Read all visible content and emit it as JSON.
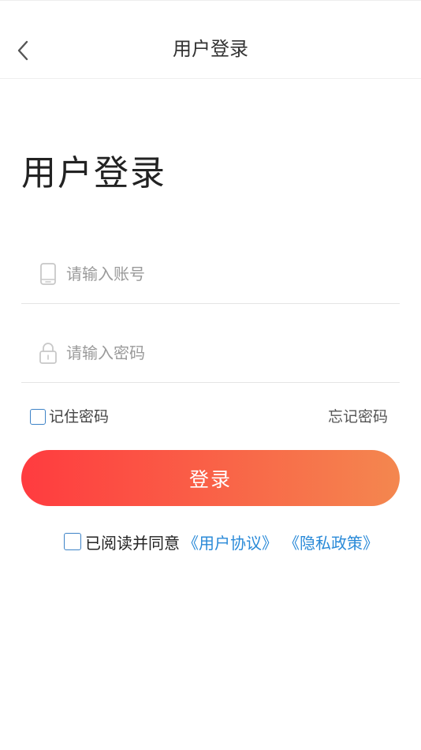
{
  "navbar": {
    "title": "用户登录",
    "back_icon": "chevron-left-icon"
  },
  "page": {
    "heading": "用户登录"
  },
  "form": {
    "account": {
      "icon": "phone-icon",
      "placeholder": "请输入账号",
      "value": ""
    },
    "password": {
      "icon": "lock-icon",
      "placeholder": "请输入密码",
      "value": ""
    },
    "remember_label": "记住密码",
    "remember_checked": false,
    "forgot_label": "忘记密码",
    "submit_label": "登录"
  },
  "agreement": {
    "checked": false,
    "prefix": "已阅读并同意",
    "user_agreement": "《用户协议》",
    "privacy_policy": "《隐私政策》"
  },
  "colors": {
    "gradient_start": "#ff3b3f",
    "gradient_end": "#f4874f",
    "link": "#2a8ad8",
    "checkbox_border": "#3d83c7"
  }
}
